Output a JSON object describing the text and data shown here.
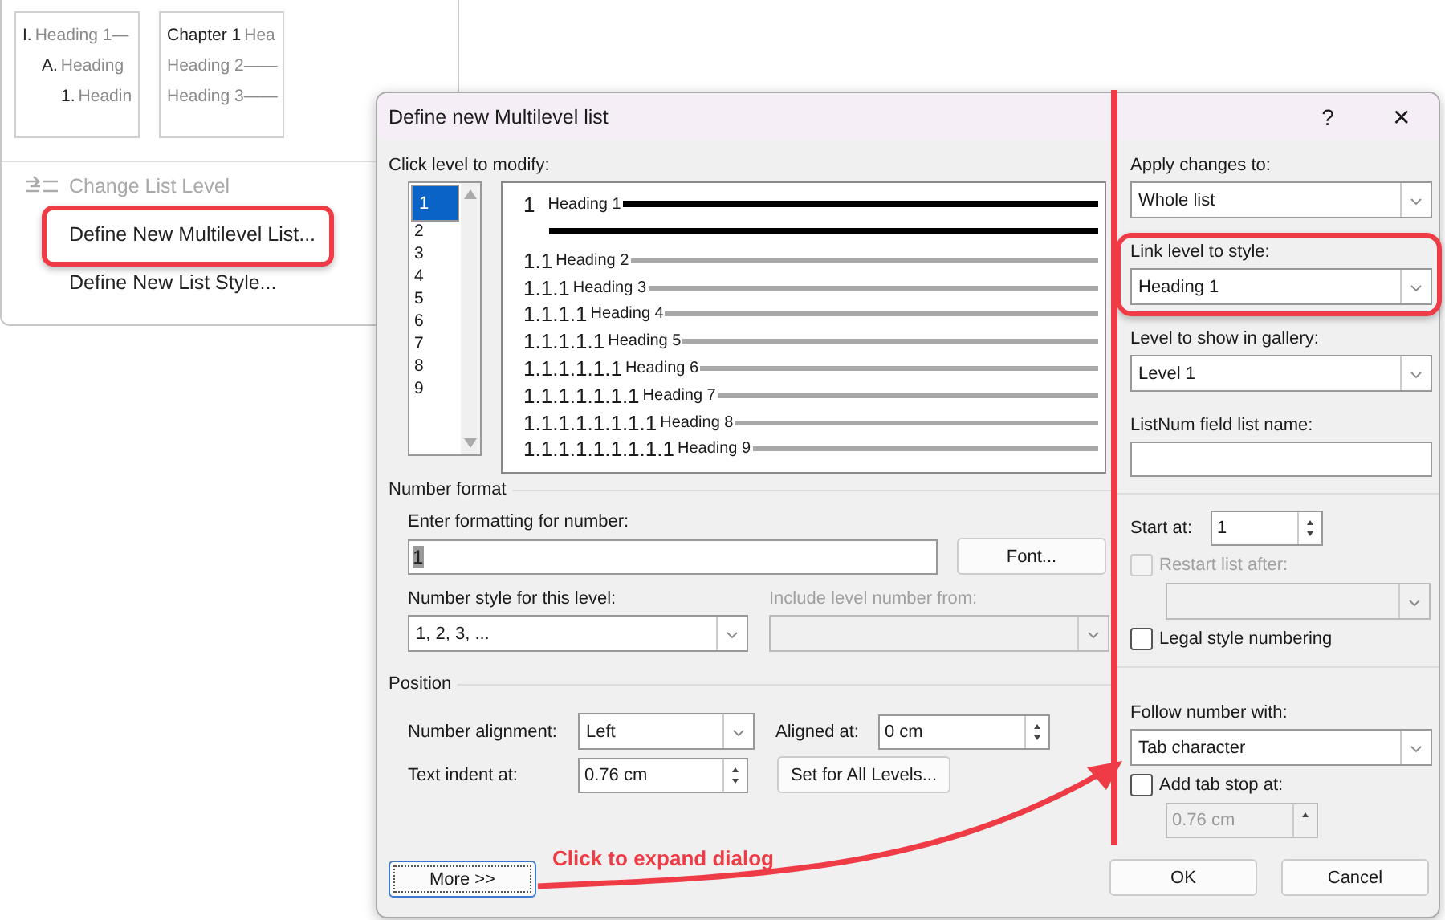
{
  "menu": {
    "galleries": [
      {
        "lines": [
          {
            "number": "I.",
            "text": "Heading 1—"
          },
          {
            "number": "A.",
            "text": "Heading"
          },
          {
            "number": "1.",
            "text": "Headin"
          }
        ]
      },
      {
        "lines": [
          {
            "number": "Chapter 1",
            "text": "Hea"
          },
          {
            "text": "Heading 2——"
          },
          {
            "text": "Heading 3——"
          }
        ]
      }
    ],
    "items": [
      {
        "label": "Change List Level",
        "disabled": true,
        "highlighted": false,
        "icon": true
      },
      {
        "label": "Define New Multilevel List...",
        "disabled": false,
        "highlighted": true,
        "icon": false
      },
      {
        "label": "Define New List Style...",
        "disabled": false,
        "highlighted": false,
        "icon": false
      }
    ]
  },
  "dialog": {
    "title": "Define new Multilevel list",
    "help": "?",
    "close": "✕",
    "level_label": "Click level to modify:",
    "levels": [
      {
        "label": "1",
        "selected": true
      },
      {
        "label": "2",
        "selected": false
      },
      {
        "label": "3",
        "selected": false
      },
      {
        "label": "4",
        "selected": false
      },
      {
        "label": "5",
        "selected": false
      },
      {
        "label": "6",
        "selected": false
      },
      {
        "label": "7",
        "selected": false
      },
      {
        "label": "8",
        "selected": false
      },
      {
        "label": "9",
        "selected": false
      }
    ],
    "preview": [
      {
        "number": "1",
        "text": "Heading 1"
      },
      {
        "number": "1.1",
        "text": "Heading 2"
      },
      {
        "number": "1.1.1",
        "text": "Heading 3"
      },
      {
        "number": "1.1.1.1",
        "text": "Heading 4"
      },
      {
        "number": "1.1.1.1.1",
        "text": "Heading 5"
      },
      {
        "number": "1.1.1.1.1.1",
        "text": "Heading 6"
      },
      {
        "number": "1.1.1.1.1.1.1",
        "text": "Heading 7"
      },
      {
        "number": "1.1.1.1.1.1.1.1",
        "text": "Heading 8"
      },
      {
        "number": "1.1.1.1.1.1.1.1.1",
        "text": "Heading 9"
      }
    ],
    "number_format": {
      "title": "Number format",
      "format_label": "Enter formatting for number:",
      "format_value": "1",
      "font_button": "Font...",
      "style_label": "Number style for this level:",
      "style_value": "1, 2, 3, ...",
      "include_label": "Include level number from:"
    },
    "position": {
      "title": "Position",
      "alignment_label": "Number alignment:",
      "alignment_value": "Left",
      "aligned_label": "Aligned at:",
      "aligned_value": "0 cm",
      "indent_label": "Text indent at:",
      "indent_value": "0.76 cm",
      "set_all_button": "Set for All Levels..."
    },
    "more_button": "More >>",
    "apply_label": "Apply changes to:",
    "apply_value": "Whole list",
    "link_label": "Link level to style:",
    "link_value": "Heading 1",
    "link_highlighted": true,
    "gallery_label": "Level to show in gallery:",
    "gallery_value": "Level 1",
    "listnum_label": "ListNum field list name:",
    "start_label": "Start at:",
    "start_value": "1",
    "restart": {
      "label": "Restart list after:",
      "checked": false,
      "disabled": true
    },
    "legal": {
      "label": "Legal style numbering",
      "checked": false,
      "disabled": false
    },
    "follow_label": "Follow number with:",
    "follow_value": "Tab character",
    "tabstop": {
      "label": "Add tab stop at:",
      "checked": false,
      "disabled": false
    },
    "tabstop_value": "0.76 cm",
    "ok": "OK",
    "cancel": "Cancel"
  },
  "annotation": {
    "text": "Click to expand dialog"
  }
}
